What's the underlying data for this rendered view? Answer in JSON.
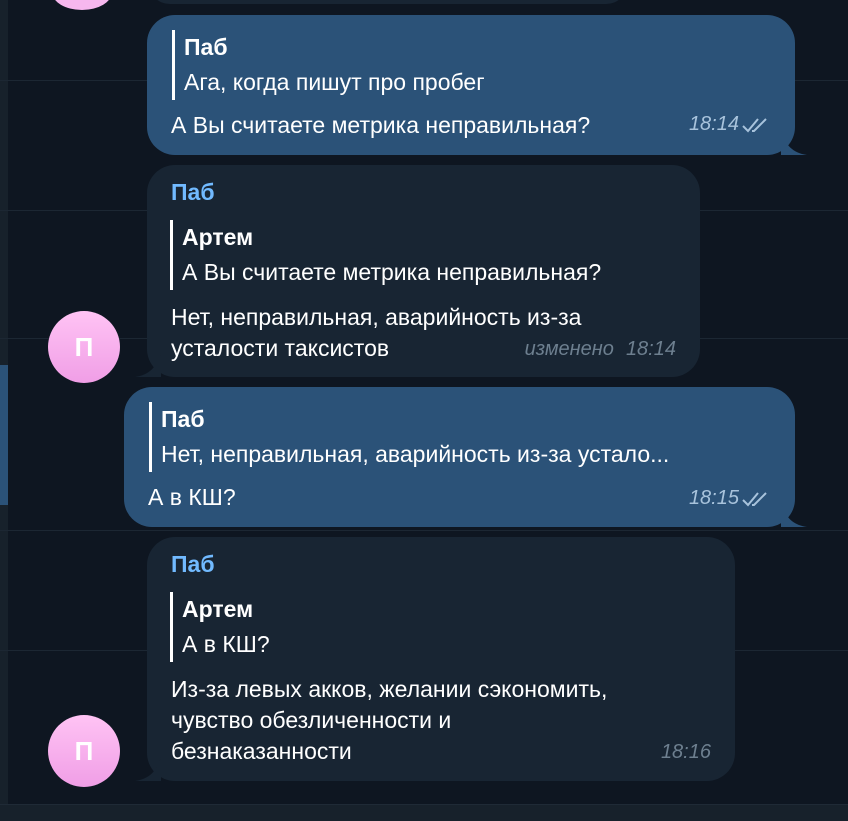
{
  "chat": {
    "avatar_letter": "П",
    "messages": [
      {
        "reply_name": "Паб",
        "reply_text": "Ага, когда пишут про пробег",
        "text": "А Вы считаете метрика неправильная?",
        "time": "18:14"
      },
      {
        "sender": "Паб",
        "reply_name": "Артем",
        "reply_text": "А Вы считаете метрика неправильная?",
        "text_line1": "Нет, неправильная, аварийность  из-за",
        "text_line2": "усталости таксистов",
        "edited": "изменено",
        "time": "18:14"
      },
      {
        "reply_name": "Паб",
        "reply_text": "Нет, неправильная, аварийность  из-за устало...",
        "text": "А в КШ?",
        "time": "18:15"
      },
      {
        "sender": "Паб",
        "reply_name": "Артем",
        "reply_text": "А в КШ?",
        "text_line1": "Из-за левых акков,  желании сэкономить,",
        "text_line2": "чувство обезличенности и",
        "text_line3": "безнаказанности",
        "time": "18:16"
      }
    ]
  },
  "icons": {
    "read_status": "double-check-icon"
  },
  "colors": {
    "background": "#0e1621",
    "outgoing_bubble": "#2b5278",
    "incoming_bubble": "#182533",
    "sender_name": "#71baff",
    "avatar": "#f6b7ee"
  }
}
